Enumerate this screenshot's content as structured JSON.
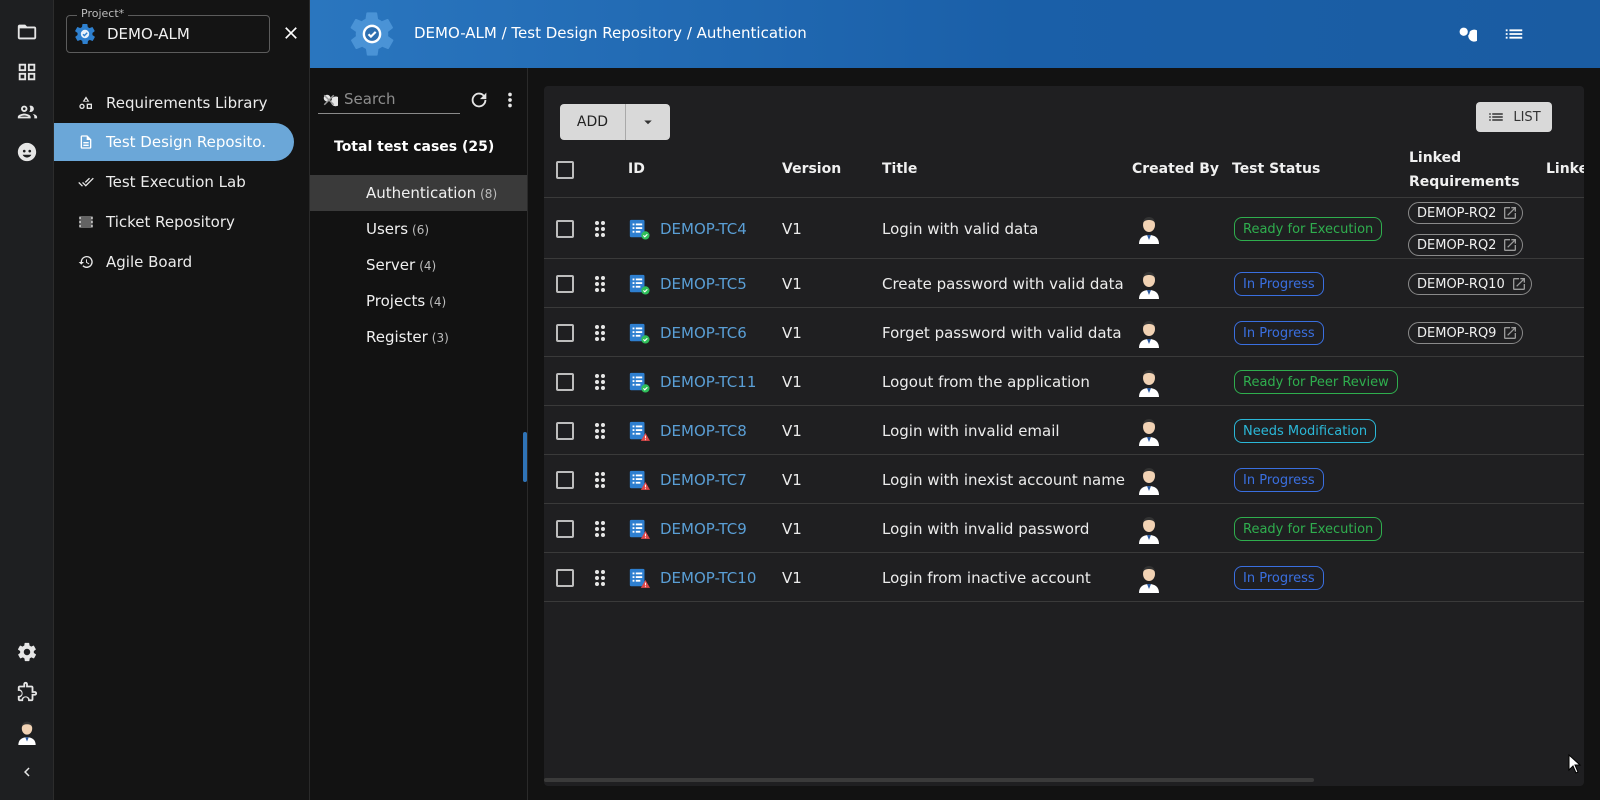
{
  "app": {
    "project_label": "Project*",
    "project_value": "DEMO-ALM",
    "breadcrumb": "DEMO-ALM / Test Design Repository / Authentication"
  },
  "icon_rail": {
    "top": [
      {
        "name": "folder-icon"
      },
      {
        "name": "dashboard-icon"
      },
      {
        "name": "people-icon"
      },
      {
        "name": "face-icon"
      }
    ],
    "bottom": [
      {
        "name": "gear-icon"
      },
      {
        "name": "puzzle-icon"
      },
      {
        "name": "user-avatar"
      },
      {
        "name": "chevron-left-icon"
      }
    ]
  },
  "nav": [
    {
      "label": "Requirements Library",
      "icon": "shapes-icon",
      "active": false
    },
    {
      "label": "Test Design Reposito.",
      "icon": "document-icon",
      "active": true
    },
    {
      "label": "Test Execution Lab",
      "icon": "double-check-icon",
      "active": false
    },
    {
      "label": "Ticket Repository",
      "icon": "storage-icon",
      "active": false
    },
    {
      "label": "Agile Board",
      "icon": "history-icon",
      "active": false
    }
  ],
  "tree": {
    "search_placeholder": "Search",
    "total_label": "Total test cases (25)",
    "folders": [
      {
        "name": "Authentication",
        "count": "(8)",
        "active": true
      },
      {
        "name": "Users",
        "count": "(6)",
        "active": false
      },
      {
        "name": "Server",
        "count": "(4)",
        "active": false
      },
      {
        "name": "Projects",
        "count": "(4)",
        "active": false
      },
      {
        "name": "Register",
        "count": "(3)",
        "active": false
      }
    ]
  },
  "toolbar": {
    "add_label": "ADD",
    "list_label": "LIST"
  },
  "table": {
    "headers": {
      "id": "ID",
      "version": "Version",
      "title": "Title",
      "created_by": "Created By",
      "test_status": "Test Status",
      "linked_requirements_1": "Linked",
      "linked_requirements_2": "Requirements",
      "linked_more": "Linke"
    },
    "rows": [
      {
        "id": "DEMOP-TC4",
        "version": "V1",
        "title": "Login with valid data",
        "status": "Ready for Execution",
        "status_kind": "green",
        "icon_badge": "check",
        "reqs": [
          "DEMOP-RQ2",
          "DEMOP-RQ2"
        ]
      },
      {
        "id": "DEMOP-TC5",
        "version": "V1",
        "title": "Create password with valid data",
        "status": "In Progress",
        "status_kind": "blue",
        "icon_badge": "check",
        "reqs": [
          "DEMOP-RQ10"
        ]
      },
      {
        "id": "DEMOP-TC6",
        "version": "V1",
        "title": "Forget password with valid data",
        "status": "In Progress",
        "status_kind": "blue",
        "icon_badge": "check",
        "reqs": [
          "DEMOP-RQ9"
        ]
      },
      {
        "id": "DEMOP-TC11",
        "version": "V1",
        "title": "Logout from the application",
        "status": "Ready for Peer Review",
        "status_kind": "green",
        "icon_badge": "check",
        "reqs": []
      },
      {
        "id": "DEMOP-TC8",
        "version": "V1",
        "title": "Login with invalid email",
        "status": "Needs Modification",
        "status_kind": "cyan",
        "icon_badge": "warning",
        "reqs": []
      },
      {
        "id": "DEMOP-TC7",
        "version": "V1",
        "title": "Login with inexist account name",
        "status": "In Progress",
        "status_kind": "blue",
        "icon_badge": "warning",
        "reqs": []
      },
      {
        "id": "DEMOP-TC9",
        "version": "V1",
        "title": "Login with invalid password",
        "status": "Ready for Execution",
        "status_kind": "green",
        "icon_badge": "warning",
        "reqs": []
      },
      {
        "id": "DEMOP-TC10",
        "version": "V1",
        "title": "Login from inactive account",
        "status": "In Progress",
        "status_kind": "blue",
        "icon_badge": "warning",
        "reqs": []
      }
    ]
  },
  "colors": {
    "accent": "#5a9fd6",
    "nav_active": "#6ba7d8",
    "header": "#1a5fa8",
    "status_green": "#2fae4e",
    "status_blue": "#3a6fe0",
    "status_cyan": "#2bb8d8",
    "badge_check": "#2fbf5a",
    "badge_warning": "#e04848"
  }
}
